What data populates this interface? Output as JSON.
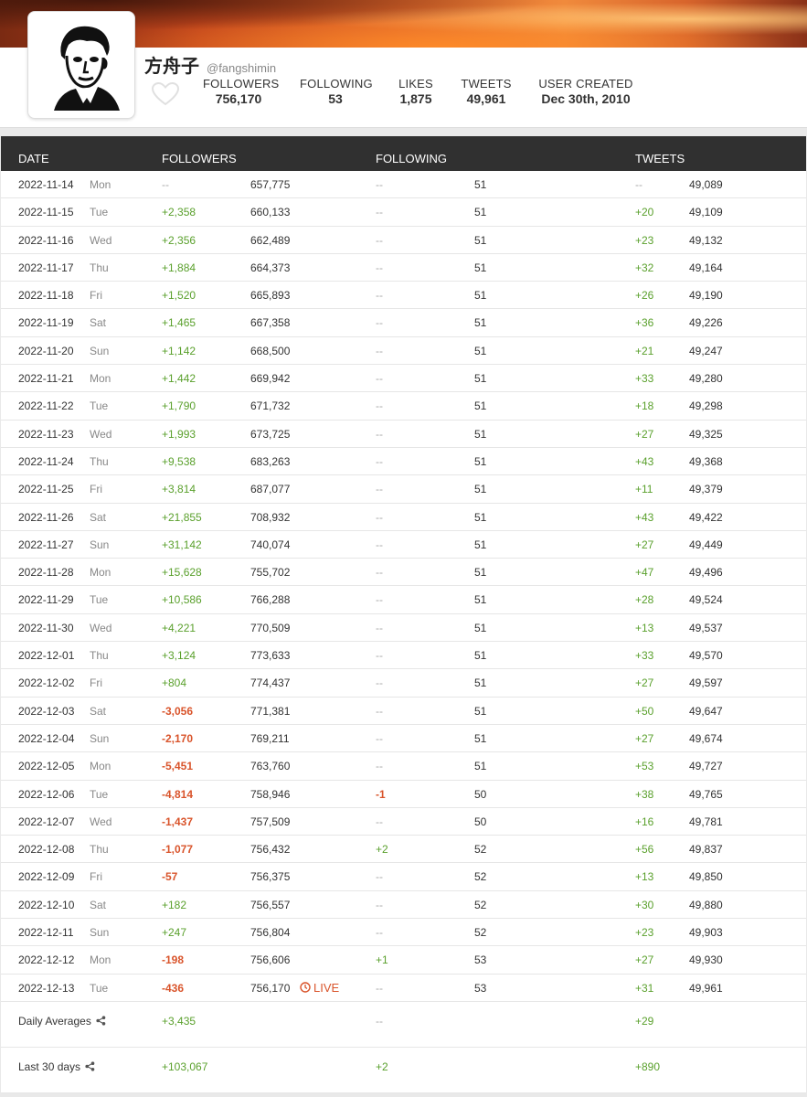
{
  "profile": {
    "name": "方舟子",
    "handle": "@fangshimin",
    "stats": [
      {
        "label": "FOLLOWERS",
        "value": "756,170"
      },
      {
        "label": "FOLLOWING",
        "value": "53"
      },
      {
        "label": "LIKES",
        "value": "1,875"
      },
      {
        "label": "TWEETS",
        "value": "49,961"
      },
      {
        "label": "USER CREATED",
        "value": "Dec 30th, 2010"
      }
    ]
  },
  "table": {
    "headers": {
      "date": "DATE",
      "followers": "FOLLOWERS",
      "following": "FOLLOWING",
      "tweets": "TWEETS"
    },
    "rows": [
      {
        "date": "2022-11-14",
        "dow": "Mon",
        "fdelta": "--",
        "ftotal": "657,775",
        "gdelta": "--",
        "gtotal": "51",
        "tdelta": "--",
        "ttotal": "49,089"
      },
      {
        "date": "2022-11-15",
        "dow": "Tue",
        "fdelta": "+2,358",
        "ftotal": "660,133",
        "gdelta": "--",
        "gtotal": "51",
        "tdelta": "+20",
        "ttotal": "49,109"
      },
      {
        "date": "2022-11-16",
        "dow": "Wed",
        "fdelta": "+2,356",
        "ftotal": "662,489",
        "gdelta": "--",
        "gtotal": "51",
        "tdelta": "+23",
        "ttotal": "49,132"
      },
      {
        "date": "2022-11-17",
        "dow": "Thu",
        "fdelta": "+1,884",
        "ftotal": "664,373",
        "gdelta": "--",
        "gtotal": "51",
        "tdelta": "+32",
        "ttotal": "49,164"
      },
      {
        "date": "2022-11-18",
        "dow": "Fri",
        "fdelta": "+1,520",
        "ftotal": "665,893",
        "gdelta": "--",
        "gtotal": "51",
        "tdelta": "+26",
        "ttotal": "49,190"
      },
      {
        "date": "2022-11-19",
        "dow": "Sat",
        "fdelta": "+1,465",
        "ftotal": "667,358",
        "gdelta": "--",
        "gtotal": "51",
        "tdelta": "+36",
        "ttotal": "49,226"
      },
      {
        "date": "2022-11-20",
        "dow": "Sun",
        "fdelta": "+1,142",
        "ftotal": "668,500",
        "gdelta": "--",
        "gtotal": "51",
        "tdelta": "+21",
        "ttotal": "49,247"
      },
      {
        "date": "2022-11-21",
        "dow": "Mon",
        "fdelta": "+1,442",
        "ftotal": "669,942",
        "gdelta": "--",
        "gtotal": "51",
        "tdelta": "+33",
        "ttotal": "49,280"
      },
      {
        "date": "2022-11-22",
        "dow": "Tue",
        "fdelta": "+1,790",
        "ftotal": "671,732",
        "gdelta": "--",
        "gtotal": "51",
        "tdelta": "+18",
        "ttotal": "49,298"
      },
      {
        "date": "2022-11-23",
        "dow": "Wed",
        "fdelta": "+1,993",
        "ftotal": "673,725",
        "gdelta": "--",
        "gtotal": "51",
        "tdelta": "+27",
        "ttotal": "49,325"
      },
      {
        "date": "2022-11-24",
        "dow": "Thu",
        "fdelta": "+9,538",
        "ftotal": "683,263",
        "gdelta": "--",
        "gtotal": "51",
        "tdelta": "+43",
        "ttotal": "49,368"
      },
      {
        "date": "2022-11-25",
        "dow": "Fri",
        "fdelta": "+3,814",
        "ftotal": "687,077",
        "gdelta": "--",
        "gtotal": "51",
        "tdelta": "+11",
        "ttotal": "49,379"
      },
      {
        "date": "2022-11-26",
        "dow": "Sat",
        "fdelta": "+21,855",
        "ftotal": "708,932",
        "gdelta": "--",
        "gtotal": "51",
        "tdelta": "+43",
        "ttotal": "49,422"
      },
      {
        "date": "2022-11-27",
        "dow": "Sun",
        "fdelta": "+31,142",
        "ftotal": "740,074",
        "gdelta": "--",
        "gtotal": "51",
        "tdelta": "+27",
        "ttotal": "49,449"
      },
      {
        "date": "2022-11-28",
        "dow": "Mon",
        "fdelta": "+15,628",
        "ftotal": "755,702",
        "gdelta": "--",
        "gtotal": "51",
        "tdelta": "+47",
        "ttotal": "49,496"
      },
      {
        "date": "2022-11-29",
        "dow": "Tue",
        "fdelta": "+10,586",
        "ftotal": "766,288",
        "gdelta": "--",
        "gtotal": "51",
        "tdelta": "+28",
        "ttotal": "49,524"
      },
      {
        "date": "2022-11-30",
        "dow": "Wed",
        "fdelta": "+4,221",
        "ftotal": "770,509",
        "gdelta": "--",
        "gtotal": "51",
        "tdelta": "+13",
        "ttotal": "49,537"
      },
      {
        "date": "2022-12-01",
        "dow": "Thu",
        "fdelta": "+3,124",
        "ftotal": "773,633",
        "gdelta": "--",
        "gtotal": "51",
        "tdelta": "+33",
        "ttotal": "49,570"
      },
      {
        "date": "2022-12-02",
        "dow": "Fri",
        "fdelta": "+804",
        "ftotal": "774,437",
        "gdelta": "--",
        "gtotal": "51",
        "tdelta": "+27",
        "ttotal": "49,597"
      },
      {
        "date": "2022-12-03",
        "dow": "Sat",
        "fdelta": "-3,056",
        "ftotal": "771,381",
        "gdelta": "--",
        "gtotal": "51",
        "tdelta": "+50",
        "ttotal": "49,647"
      },
      {
        "date": "2022-12-04",
        "dow": "Sun",
        "fdelta": "-2,170",
        "ftotal": "769,211",
        "gdelta": "--",
        "gtotal": "51",
        "tdelta": "+27",
        "ttotal": "49,674"
      },
      {
        "date": "2022-12-05",
        "dow": "Mon",
        "fdelta": "-5,451",
        "ftotal": "763,760",
        "gdelta": "--",
        "gtotal": "51",
        "tdelta": "+53",
        "ttotal": "49,727"
      },
      {
        "date": "2022-12-06",
        "dow": "Tue",
        "fdelta": "-4,814",
        "ftotal": "758,946",
        "gdelta": "-1",
        "gtotal": "50",
        "tdelta": "+38",
        "ttotal": "49,765"
      },
      {
        "date": "2022-12-07",
        "dow": "Wed",
        "fdelta": "-1,437",
        "ftotal": "757,509",
        "gdelta": "--",
        "gtotal": "50",
        "tdelta": "+16",
        "ttotal": "49,781"
      },
      {
        "date": "2022-12-08",
        "dow": "Thu",
        "fdelta": "-1,077",
        "ftotal": "756,432",
        "gdelta": "+2",
        "gtotal": "52",
        "tdelta": "+56",
        "ttotal": "49,837"
      },
      {
        "date": "2022-12-09",
        "dow": "Fri",
        "fdelta": "-57",
        "ftotal": "756,375",
        "gdelta": "--",
        "gtotal": "52",
        "tdelta": "+13",
        "ttotal": "49,850"
      },
      {
        "date": "2022-12-10",
        "dow": "Sat",
        "fdelta": "+182",
        "ftotal": "756,557",
        "gdelta": "--",
        "gtotal": "52",
        "tdelta": "+30",
        "ttotal": "49,880"
      },
      {
        "date": "2022-12-11",
        "dow": "Sun",
        "fdelta": "+247",
        "ftotal": "756,804",
        "gdelta": "--",
        "gtotal": "52",
        "tdelta": "+23",
        "ttotal": "49,903"
      },
      {
        "date": "2022-12-12",
        "dow": "Mon",
        "fdelta": "-198",
        "ftotal": "756,606",
        "gdelta": "+1",
        "gtotal": "53",
        "tdelta": "+27",
        "ttotal": "49,930"
      },
      {
        "date": "2022-12-13",
        "dow": "Tue",
        "fdelta": "-436",
        "ftotal": "756,170",
        "live": "LIVE",
        "gdelta": "--",
        "gtotal": "53",
        "tdelta": "+31",
        "ttotal": "49,961"
      }
    ],
    "summaries": [
      {
        "label": "Daily Averages",
        "fdelta": "+3,435",
        "gdelta": "--",
        "tdelta": "+29"
      },
      {
        "label": "Last 30 days",
        "fdelta": "+103,067",
        "gdelta": "+2",
        "tdelta": "+890"
      }
    ]
  },
  "colors": {
    "positive": "#5aa02c",
    "negative": "#d9542b",
    "header_bg": "#303030"
  }
}
